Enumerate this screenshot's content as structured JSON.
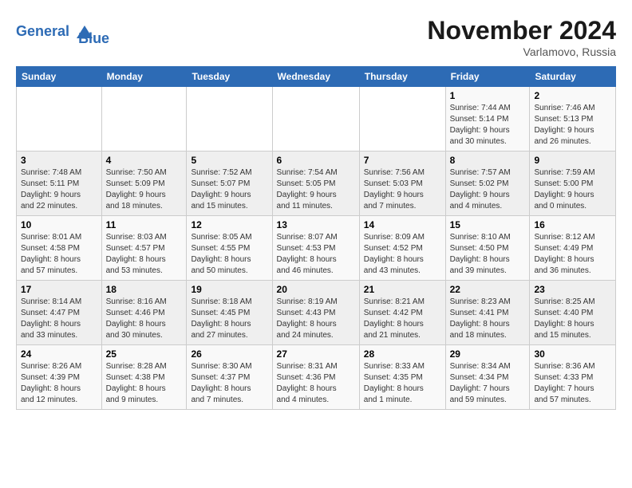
{
  "header": {
    "logo_line1": "General",
    "logo_line2": "Blue",
    "month": "November 2024",
    "location": "Varlamovo, Russia"
  },
  "weekdays": [
    "Sunday",
    "Monday",
    "Tuesday",
    "Wednesday",
    "Thursday",
    "Friday",
    "Saturday"
  ],
  "weeks": [
    [
      {
        "day": "",
        "info": ""
      },
      {
        "day": "",
        "info": ""
      },
      {
        "day": "",
        "info": ""
      },
      {
        "day": "",
        "info": ""
      },
      {
        "day": "",
        "info": ""
      },
      {
        "day": "1",
        "info": "Sunrise: 7:44 AM\nSunset: 5:14 PM\nDaylight: 9 hours\nand 30 minutes."
      },
      {
        "day": "2",
        "info": "Sunrise: 7:46 AM\nSunset: 5:13 PM\nDaylight: 9 hours\nand 26 minutes."
      }
    ],
    [
      {
        "day": "3",
        "info": "Sunrise: 7:48 AM\nSunset: 5:11 PM\nDaylight: 9 hours\nand 22 minutes."
      },
      {
        "day": "4",
        "info": "Sunrise: 7:50 AM\nSunset: 5:09 PM\nDaylight: 9 hours\nand 18 minutes."
      },
      {
        "day": "5",
        "info": "Sunrise: 7:52 AM\nSunset: 5:07 PM\nDaylight: 9 hours\nand 15 minutes."
      },
      {
        "day": "6",
        "info": "Sunrise: 7:54 AM\nSunset: 5:05 PM\nDaylight: 9 hours\nand 11 minutes."
      },
      {
        "day": "7",
        "info": "Sunrise: 7:56 AM\nSunset: 5:03 PM\nDaylight: 9 hours\nand 7 minutes."
      },
      {
        "day": "8",
        "info": "Sunrise: 7:57 AM\nSunset: 5:02 PM\nDaylight: 9 hours\nand 4 minutes."
      },
      {
        "day": "9",
        "info": "Sunrise: 7:59 AM\nSunset: 5:00 PM\nDaylight: 9 hours\nand 0 minutes."
      }
    ],
    [
      {
        "day": "10",
        "info": "Sunrise: 8:01 AM\nSunset: 4:58 PM\nDaylight: 8 hours\nand 57 minutes."
      },
      {
        "day": "11",
        "info": "Sunrise: 8:03 AM\nSunset: 4:57 PM\nDaylight: 8 hours\nand 53 minutes."
      },
      {
        "day": "12",
        "info": "Sunrise: 8:05 AM\nSunset: 4:55 PM\nDaylight: 8 hours\nand 50 minutes."
      },
      {
        "day": "13",
        "info": "Sunrise: 8:07 AM\nSunset: 4:53 PM\nDaylight: 8 hours\nand 46 minutes."
      },
      {
        "day": "14",
        "info": "Sunrise: 8:09 AM\nSunset: 4:52 PM\nDaylight: 8 hours\nand 43 minutes."
      },
      {
        "day": "15",
        "info": "Sunrise: 8:10 AM\nSunset: 4:50 PM\nDaylight: 8 hours\nand 39 minutes."
      },
      {
        "day": "16",
        "info": "Sunrise: 8:12 AM\nSunset: 4:49 PM\nDaylight: 8 hours\nand 36 minutes."
      }
    ],
    [
      {
        "day": "17",
        "info": "Sunrise: 8:14 AM\nSunset: 4:47 PM\nDaylight: 8 hours\nand 33 minutes."
      },
      {
        "day": "18",
        "info": "Sunrise: 8:16 AM\nSunset: 4:46 PM\nDaylight: 8 hours\nand 30 minutes."
      },
      {
        "day": "19",
        "info": "Sunrise: 8:18 AM\nSunset: 4:45 PM\nDaylight: 8 hours\nand 27 minutes."
      },
      {
        "day": "20",
        "info": "Sunrise: 8:19 AM\nSunset: 4:43 PM\nDaylight: 8 hours\nand 24 minutes."
      },
      {
        "day": "21",
        "info": "Sunrise: 8:21 AM\nSunset: 4:42 PM\nDaylight: 8 hours\nand 21 minutes."
      },
      {
        "day": "22",
        "info": "Sunrise: 8:23 AM\nSunset: 4:41 PM\nDaylight: 8 hours\nand 18 minutes."
      },
      {
        "day": "23",
        "info": "Sunrise: 8:25 AM\nSunset: 4:40 PM\nDaylight: 8 hours\nand 15 minutes."
      }
    ],
    [
      {
        "day": "24",
        "info": "Sunrise: 8:26 AM\nSunset: 4:39 PM\nDaylight: 8 hours\nand 12 minutes."
      },
      {
        "day": "25",
        "info": "Sunrise: 8:28 AM\nSunset: 4:38 PM\nDaylight: 8 hours\nand 9 minutes."
      },
      {
        "day": "26",
        "info": "Sunrise: 8:30 AM\nSunset: 4:37 PM\nDaylight: 8 hours\nand 7 minutes."
      },
      {
        "day": "27",
        "info": "Sunrise: 8:31 AM\nSunset: 4:36 PM\nDaylight: 8 hours\nand 4 minutes."
      },
      {
        "day": "28",
        "info": "Sunrise: 8:33 AM\nSunset: 4:35 PM\nDaylight: 8 hours\nand 1 minute."
      },
      {
        "day": "29",
        "info": "Sunrise: 8:34 AM\nSunset: 4:34 PM\nDaylight: 7 hours\nand 59 minutes."
      },
      {
        "day": "30",
        "info": "Sunrise: 8:36 AM\nSunset: 4:33 PM\nDaylight: 7 hours\nand 57 minutes."
      }
    ]
  ]
}
